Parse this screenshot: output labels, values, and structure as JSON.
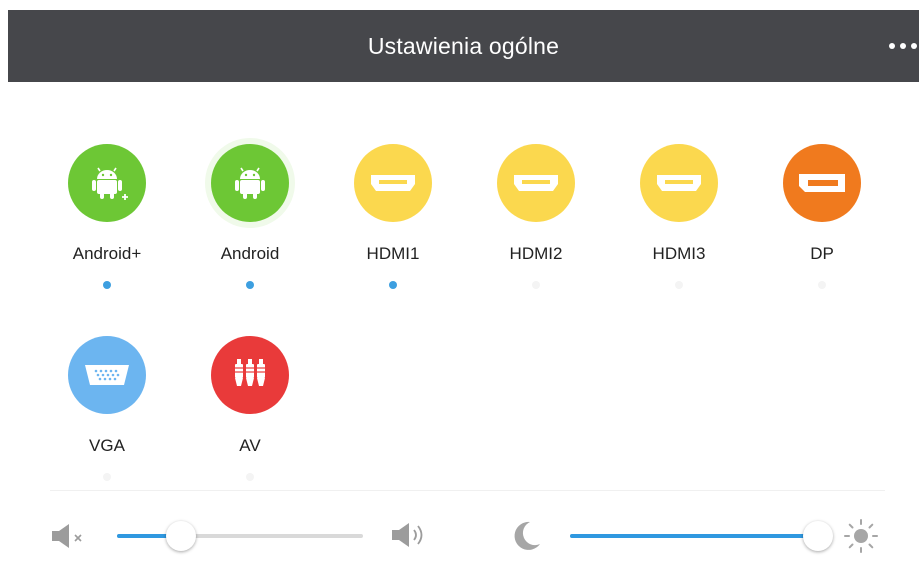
{
  "header": {
    "title": "Ustawienia ogólne",
    "more_icon": "more-dots-icon"
  },
  "sources": [
    {
      "label": "Android+",
      "icon": "android-plus-icon",
      "color": "#6dc735",
      "indicator_on": true
    },
    {
      "label": "Android",
      "icon": "android-icon",
      "color": "#6dc735",
      "indicator_on": true
    },
    {
      "label": "HDMI1",
      "icon": "hdmi-icon",
      "color": "#fbd84e",
      "indicator_on": true
    },
    {
      "label": "HDMI2",
      "icon": "hdmi-icon",
      "color": "#fbd84e",
      "indicator_on": false
    },
    {
      "label": "HDMI3",
      "icon": "hdmi-icon",
      "color": "#fbd84e",
      "indicator_on": false
    },
    {
      "label": "DP",
      "icon": "displayport-icon",
      "color": "#f07a1e",
      "indicator_on": false
    },
    {
      "label": "VGA",
      "icon": "vga-icon",
      "color": "#6cb5f0",
      "indicator_on": false
    },
    {
      "label": "AV",
      "icon": "av-rca-icon",
      "color": "#e93a3a",
      "indicator_on": false
    }
  ],
  "volume": {
    "level": 0.26,
    "min_icon": "volume-mute-icon",
    "max_icon": "volume-up-icon"
  },
  "brightness": {
    "level": 1.0,
    "min_icon": "moon-icon",
    "max_icon": "sun-icon"
  },
  "colors": {
    "header_bg": "#46474b",
    "indicator_active": "#3d9fe0",
    "slider_fill": "#2f98e0"
  }
}
